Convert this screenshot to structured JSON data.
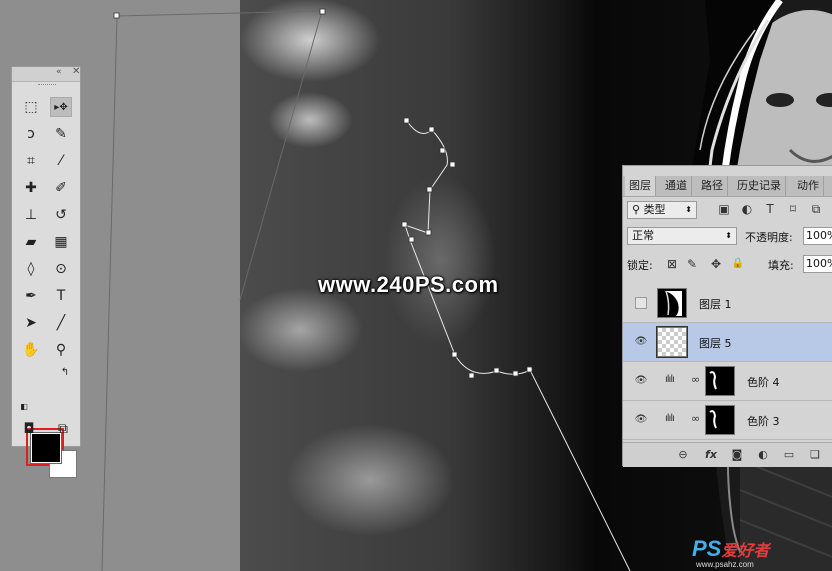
{
  "watermark": "www.240PS.com",
  "logo": {
    "ps": "PS",
    "cn": "爱好者",
    "url": "www.psahz.com"
  },
  "toolbox": {
    "collapse_icon": "«",
    "close_icon": "✕",
    "foreground_color": "#000000",
    "background_color": "#ffffff",
    "tools": [
      {
        "name": "marquee-tool-icon",
        "glyph": "⬚",
        "selected": false
      },
      {
        "name": "move-tool-icon",
        "glyph": "▸✥",
        "selected": true
      },
      {
        "name": "lasso-tool-icon",
        "glyph": "ↄ",
        "selected": false
      },
      {
        "name": "quick-selection-tool-icon",
        "glyph": "✎",
        "selected": false
      },
      {
        "name": "crop-tool-icon",
        "glyph": "⌗",
        "selected": false
      },
      {
        "name": "eyedropper-tool-icon",
        "glyph": "⁄",
        "selected": false
      },
      {
        "name": "healing-brush-tool-icon",
        "glyph": "✚",
        "selected": false
      },
      {
        "name": "brush-tool-icon",
        "glyph": "✐",
        "selected": false
      },
      {
        "name": "clone-stamp-tool-icon",
        "glyph": "⊥",
        "selected": false
      },
      {
        "name": "history-brush-tool-icon",
        "glyph": "↺",
        "selected": false
      },
      {
        "name": "eraser-tool-icon",
        "glyph": "▰",
        "selected": false
      },
      {
        "name": "gradient-tool-icon",
        "glyph": "▦",
        "selected": false
      },
      {
        "name": "blur-tool-icon",
        "glyph": "◊",
        "selected": false
      },
      {
        "name": "dodge-tool-icon",
        "glyph": "⊙",
        "selected": false
      },
      {
        "name": "pen-tool-icon",
        "glyph": "✒",
        "selected": false
      },
      {
        "name": "type-tool-icon",
        "glyph": "T",
        "selected": false
      },
      {
        "name": "path-selection-tool-icon",
        "glyph": "➤",
        "selected": false
      },
      {
        "name": "line-tool-icon",
        "glyph": "╱",
        "selected": false
      },
      {
        "name": "hand-tool-icon",
        "glyph": "✋",
        "selected": false
      },
      {
        "name": "zoom-tool-icon",
        "glyph": "⚲",
        "selected": false
      }
    ]
  },
  "layers_panel": {
    "tabs": [
      "图层",
      "通道",
      "路径",
      "历史记录",
      "动作"
    ],
    "active_tab": 0,
    "filter": {
      "label": "类型",
      "icons": [
        "image-filter-icon",
        "adjustment-filter-icon",
        "type-filter-icon",
        "shape-filter-icon",
        "smart-object-filter-icon"
      ],
      "glyphs": [
        "▣",
        "◐",
        "T",
        "⌑",
        "⧉"
      ]
    },
    "blend_mode": "正常",
    "opacity_label": "不透明度:",
    "opacity_value": "100%",
    "lock_label": "锁定:",
    "lock_glyphs": [
      "⊠",
      "✎",
      "✥",
      "🔒"
    ],
    "fill_label": "填充:",
    "fill_value": "100%",
    "layers": [
      {
        "name": "图层 1",
        "visible": false,
        "selected": false,
        "thumb": "photo",
        "adjustment": false
      },
      {
        "name": "图层 5",
        "visible": true,
        "selected": true,
        "thumb": "transparent",
        "adjustment": false
      },
      {
        "name": "色阶 4",
        "visible": true,
        "selected": false,
        "thumb": "mask",
        "adjustment": true
      },
      {
        "name": "色阶 3",
        "visible": true,
        "selected": false,
        "thumb": "mask",
        "adjustment": true
      }
    ],
    "bottom_icons": [
      {
        "name": "link-layers-icon",
        "glyph": "⊖"
      },
      {
        "name": "layer-style-icon",
        "glyph": "fx"
      },
      {
        "name": "add-mask-icon",
        "glyph": "◙"
      },
      {
        "name": "adjustment-layer-icon",
        "glyph": "◐"
      },
      {
        "name": "new-group-icon",
        "glyph": "▭"
      },
      {
        "name": "new-layer-icon",
        "glyph": "❏"
      }
    ]
  }
}
